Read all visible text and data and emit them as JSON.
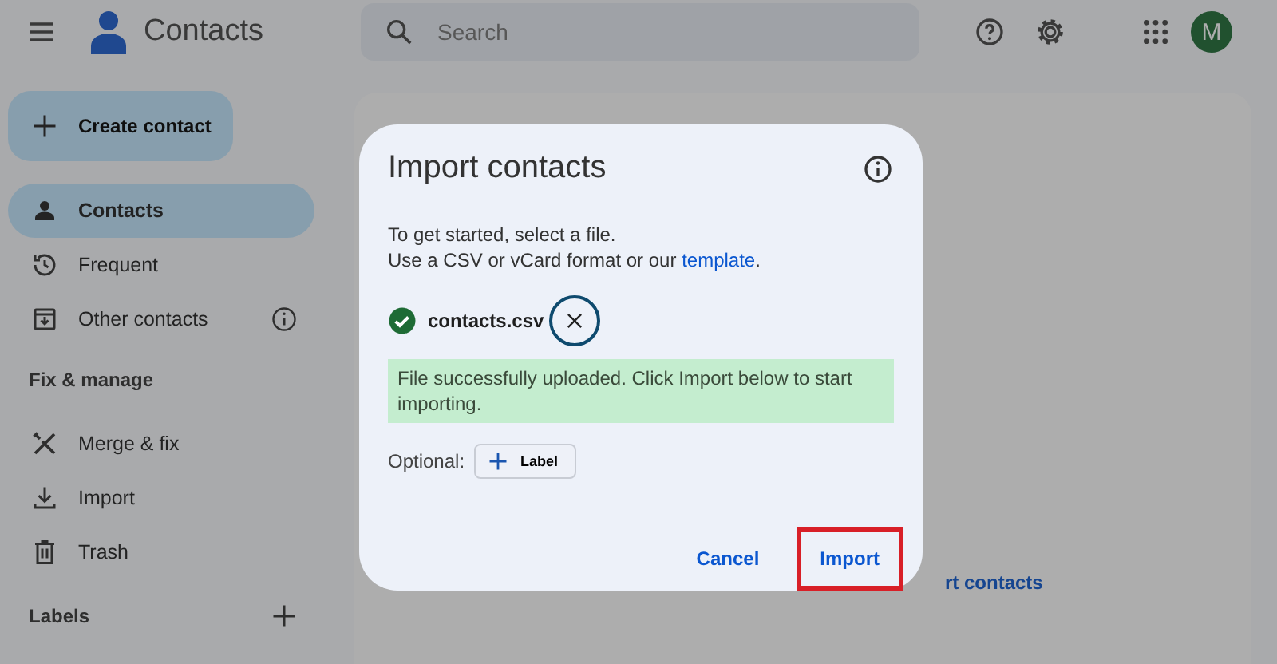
{
  "app": {
    "title": "Contacts"
  },
  "search": {
    "placeholder": "Search"
  },
  "account": {
    "initial": "M"
  },
  "create_button": {
    "label": "Create contact"
  },
  "nav": [
    {
      "label": "Contacts",
      "kind": "plain",
      "selected": true
    },
    {
      "label": "Frequent",
      "kind": "plain",
      "selected": false
    },
    {
      "label": "Other contacts",
      "kind": "with_info",
      "selected": false
    }
  ],
  "fix_section": {
    "title": "Fix & manage",
    "items": [
      {
        "label": "Merge & fix"
      },
      {
        "label": "Import"
      },
      {
        "label": "Trash"
      }
    ]
  },
  "labels_section": {
    "title": "Labels"
  },
  "background_link": {
    "label": "rt contacts"
  },
  "dialog": {
    "title": "Import contacts",
    "line1": "To get started, select a file.",
    "line2": "Use a CSV or vCard format or our ",
    "link": "template",
    "line2_end": ".",
    "file": {
      "name": "contacts.csv",
      "uploaded": true
    },
    "message": "File successfully uploaded. Click Import below to start importing.",
    "optional_label": "Optional:",
    "label_button": "Label",
    "buttons": [
      {
        "label": "Cancel",
        "highlighted": false
      },
      {
        "label": "Import",
        "highlighted": true
      }
    ]
  }
}
